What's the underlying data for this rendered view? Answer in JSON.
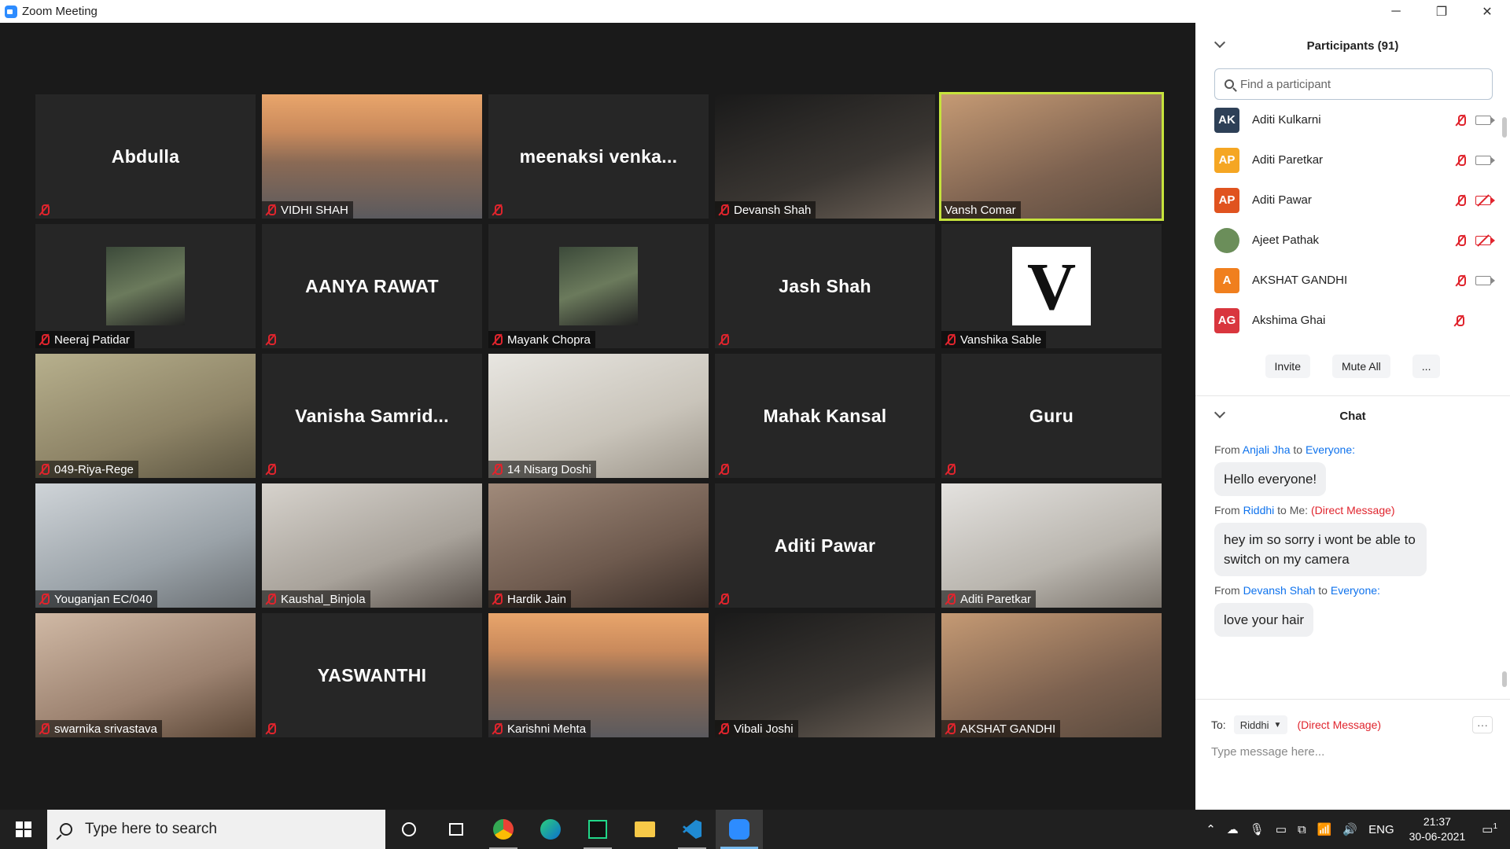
{
  "window": {
    "title": "Zoom Meeting",
    "minimize": "─",
    "maximize": "❐",
    "close": "✕"
  },
  "tiles": [
    {
      "name": "Abdulla",
      "mode": "name",
      "muted": true
    },
    {
      "name": "VIDHI SHAH",
      "mode": "video",
      "muted": true
    },
    {
      "name": "meenaksi  venka...",
      "mode": "name",
      "muted": true
    },
    {
      "name": "Devansh Shah",
      "mode": "video",
      "muted": true
    },
    {
      "name": "Vansh Comar",
      "mode": "video",
      "muted": false,
      "active": true
    },
    {
      "name": "Neeraj Patidar",
      "mode": "thumb",
      "muted": true
    },
    {
      "name": "AANYA RAWAT",
      "mode": "name",
      "muted": true
    },
    {
      "name": "Mayank Chopra",
      "mode": "thumb",
      "muted": true
    },
    {
      "name": "Jash Shah",
      "mode": "name",
      "muted": true
    },
    {
      "name": "Vanshika Sable",
      "mode": "letter",
      "letter": "V",
      "muted": true
    },
    {
      "name": "049-Riya-Rege",
      "mode": "video",
      "muted": true
    },
    {
      "name": "Vanisha  Samrid...",
      "mode": "name",
      "muted": true
    },
    {
      "name": "14 Nisarg Doshi",
      "mode": "video",
      "muted": true
    },
    {
      "name": "Mahak Kansal",
      "mode": "name",
      "muted": true
    },
    {
      "name": "Guru",
      "mode": "name",
      "muted": true
    },
    {
      "name": "Youganjan EC/040",
      "mode": "video",
      "muted": true
    },
    {
      "name": "Kaushal_Binjola",
      "mode": "video",
      "muted": true
    },
    {
      "name": "Hardik Jain",
      "mode": "video",
      "muted": true
    },
    {
      "name": "Aditi Pawar",
      "mode": "name",
      "muted": true
    },
    {
      "name": "Aditi Paretkar",
      "mode": "video",
      "muted": true
    },
    {
      "name": "swarnika srivastava",
      "mode": "video",
      "muted": true
    },
    {
      "name": "YASWANTHI",
      "mode": "name",
      "muted": true
    },
    {
      "name": "Karishni Mehta",
      "mode": "video",
      "muted": true
    },
    {
      "name": "Vibali Joshi",
      "mode": "video",
      "muted": true
    },
    {
      "name": "AKSHAT GANDHI",
      "mode": "video",
      "muted": true
    }
  ],
  "participants": {
    "title": "Participants (91)",
    "search_placeholder": "Find a participant",
    "items": [
      {
        "initials": "AK",
        "name": "Aditi Kulkarni",
        "color": "#2e4057",
        "mic": "muted",
        "cam": "on"
      },
      {
        "initials": "AP",
        "name": "Aditi Paretkar",
        "color": "#f5a623",
        "mic": "muted",
        "cam": "on"
      },
      {
        "initials": "AP",
        "name": "Aditi Pawar",
        "color": "#e0531f",
        "mic": "muted",
        "cam": "off"
      },
      {
        "initials": "",
        "name": "Ajeet Pathak",
        "color": "#6b8e5a",
        "mic": "muted",
        "cam": "off"
      },
      {
        "initials": "A",
        "name": "AKSHAT GANDHI",
        "color": "#f07f1e",
        "mic": "muted",
        "cam": "on"
      },
      {
        "initials": "AG",
        "name": "Akshima Ghai",
        "color": "#d9363e",
        "mic": "muted",
        "cam": "none"
      }
    ],
    "invite": "Invite",
    "mute_all": "Mute All",
    "more": "..."
  },
  "chat": {
    "title": "Chat",
    "messages": [
      {
        "from": "Anjali Jha",
        "to": "Everyone:",
        "dm": "",
        "text": "Hello everyone!"
      },
      {
        "from": "Riddhi",
        "to": "Me:",
        "dm": "(Direct Message)",
        "text": "hey im so sorry i wont be able to switch on my camera"
      },
      {
        "from": "Devansh Shah",
        "to": "Everyone:",
        "dm": "",
        "text": "love your hair"
      }
    ],
    "from_word": "From",
    "to_word": "to",
    "to_label": "To:",
    "recipient": "Riddhi",
    "recipient_note": "(Direct Message)",
    "placeholder": "Type message here...",
    "more": "···"
  },
  "taskbar": {
    "search_placeholder": "Type here to search",
    "lang": "ENG",
    "time": "21:37",
    "date": "30-06-2021",
    "notif_count": "1"
  }
}
